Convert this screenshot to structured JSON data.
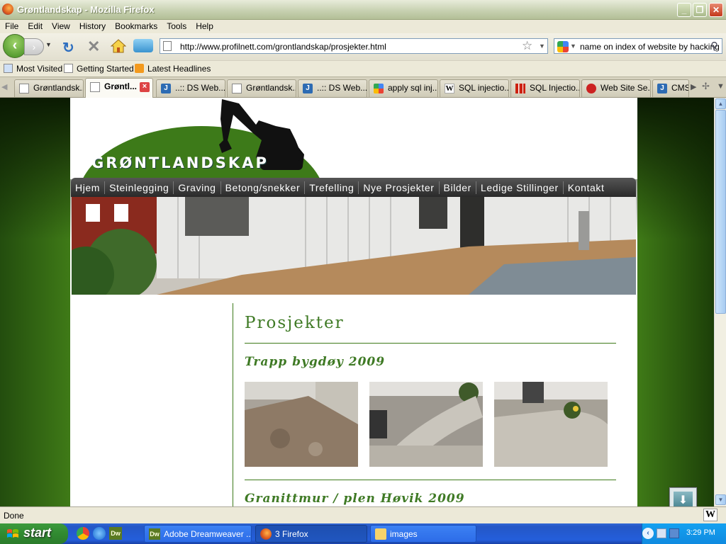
{
  "window": {
    "title": "Grøntlandskap - Mozilla Firefox"
  },
  "menu": [
    "File",
    "Edit",
    "View",
    "History",
    "Bookmarks",
    "Tools",
    "Help"
  ],
  "nav": {
    "url": "http://www.profilnett.com/grontlandskap/prosjekter.html",
    "search": "name on index of website by hacking"
  },
  "bookmarks": [
    "Most Visited",
    "Getting Started",
    "Latest Headlines"
  ],
  "tabs": [
    {
      "label": "Grøntlandsk...",
      "icon": "page-icon"
    },
    {
      "label": "Grøntl...",
      "icon": "page-icon",
      "active": true
    },
    {
      "label": "..:: DS Web...",
      "icon": "ds-icon"
    },
    {
      "label": "Grøntlandsk...",
      "icon": "page-icon"
    },
    {
      "label": "..:: DS Web...",
      "icon": "ds-icon"
    },
    {
      "label": "apply sql inj...",
      "icon": "google-icon"
    },
    {
      "label": "SQL injectio...",
      "icon": "wikipedia-icon"
    },
    {
      "label": "SQL Injectio...",
      "icon": "sql-icon"
    },
    {
      "label": "Web Site Se...",
      "icon": "website-icon"
    },
    {
      "label": "CMS",
      "icon": "ds-icon"
    }
  ],
  "site": {
    "logo": "GRØNTLANDSKAP",
    "menu": [
      "Hjem",
      "Steinlegging",
      "Graving",
      "Betong/snekker",
      "Trefelling",
      "Nye Prosjekter",
      "Bilder",
      "Ledige Stillinger",
      "Kontakt"
    ],
    "page_title": "Prosjekter",
    "sections": [
      "Trapp bygdøy 2009",
      "Granittmur / plen Høvik 2009"
    ]
  },
  "status": {
    "text": "Done"
  },
  "taskbar": {
    "start": "start",
    "tasks": [
      "Adobe Dreamweaver ...",
      "3 Firefox",
      "images"
    ],
    "clock": "3:29 PM"
  },
  "colors": {
    "site_green": "#3d7a19",
    "heading_green": "#3f7a25",
    "taskbar_blue": "#245edb",
    "start_green": "#318a31"
  }
}
